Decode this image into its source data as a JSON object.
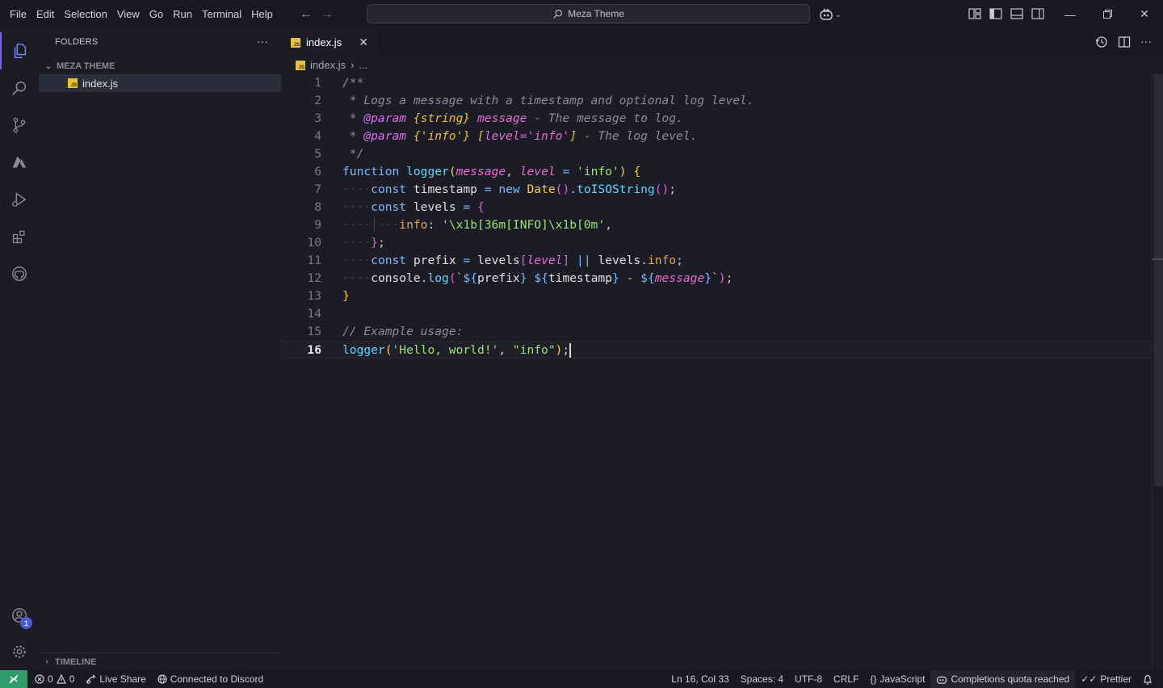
{
  "menu": [
    "File",
    "Edit",
    "Selection",
    "View",
    "Go",
    "Run",
    "Terminal",
    "Help"
  ],
  "search": {
    "text": "Meza Theme"
  },
  "sidebar": {
    "header": "FOLDERS",
    "folder": "MEZA THEME",
    "file": "index.js",
    "timeline": "TIMELINE"
  },
  "tab": {
    "label": "index.js"
  },
  "breadcrumb": {
    "file": "index.js",
    "more": "..."
  },
  "editor": {
    "line_numbers": [
      "1",
      "2",
      "3",
      "4",
      "5",
      "6",
      "7",
      "8",
      "9",
      "10",
      "11",
      "12",
      "13",
      "14",
      "15",
      "16"
    ],
    "current_line": 16
  },
  "activity_badge": "1",
  "statusbar": {
    "errors": "0",
    "warnings": "0",
    "live_share": "Live Share",
    "discord": "Connected to Discord",
    "cursor": "Ln 16, Col 33",
    "spaces": "Spaces: 4",
    "encoding": "UTF-8",
    "eol": "CRLF",
    "language": "JavaScript",
    "copilot": "Completions quota reached",
    "prettier": "Prettier"
  },
  "colors": {
    "accent": "#7b5cf0",
    "remote": "#2e9d6a",
    "comment": "#8c8c9a",
    "keyword": "#7fb8ff",
    "function": "#62d7ff",
    "string": "#9be376",
    "param": "#e96bd4"
  },
  "icons": [
    "explorer-icon",
    "search-icon",
    "source-control-icon",
    "azure-icon",
    "run-debug-icon",
    "extensions-icon",
    "github-icon",
    "account-icon",
    "settings-icon"
  ]
}
